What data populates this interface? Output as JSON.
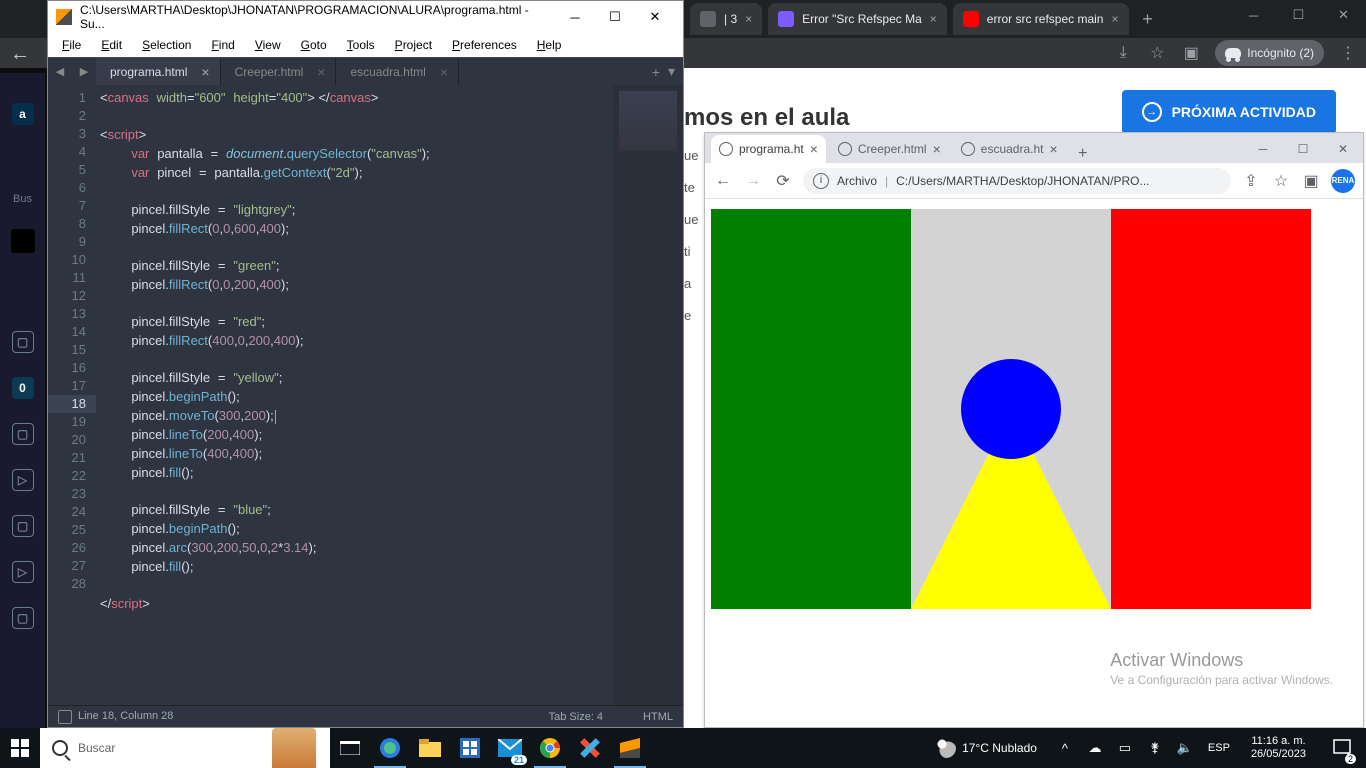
{
  "sublime": {
    "title": "C:\\Users\\MARTHA\\Desktop\\JHONATAN\\PROGRAMACION\\ALURA\\programa.html - Su...",
    "menu": [
      "File",
      "Edit",
      "Selection",
      "Find",
      "View",
      "Goto",
      "Tools",
      "Project",
      "Preferences",
      "Help"
    ],
    "tabs": [
      {
        "label": "programa.html",
        "active": true
      },
      {
        "label": "Creeper.html",
        "active": false
      },
      {
        "label": "escuadra.html",
        "active": false
      }
    ],
    "lines": [
      "1",
      "2",
      "3",
      "4",
      "5",
      "6",
      "7",
      "8",
      "9",
      "10",
      "11",
      "12",
      "13",
      "14",
      "15",
      "16",
      "17",
      "18",
      "19",
      "20",
      "21",
      "22",
      "23",
      "24",
      "25",
      "26",
      "27",
      "28"
    ],
    "current_line_index": 17,
    "status": {
      "pos": "Line 18, Column 28",
      "tab": "Tab Size: 4",
      "lang": "HTML"
    }
  },
  "bg_browser": {
    "tabs": [
      {
        "label": "| 3"
      },
      {
        "label": "Error \"Src Refspec Ma"
      },
      {
        "label": "error src refspec main"
      }
    ],
    "incognito": "Incógnito (2)",
    "heading": "mos en el aula",
    "next_btn": "PRÓXIMA ACTIVIDAD",
    "frag": "ue\nte\nue\nti\na\ne",
    "sidebar": {
      "logo": "a",
      "search": "Bus",
      "zero": "0"
    }
  },
  "chrome": {
    "tabs": [
      {
        "label": "programa.ht",
        "active": true
      },
      {
        "label": "Creeper.html",
        "active": false
      },
      {
        "label": "escuadra.ht",
        "active": false
      }
    ],
    "url_label": "Archivo",
    "url": "C:/Users/MARTHA/Desktop/JHONATAN/PRO..."
  },
  "watermark": {
    "t1": "Activar Windows",
    "t2": "Ve a Configuración para activar Windows."
  },
  "taskbar": {
    "search_placeholder": "Buscar",
    "weather": "17°C  Nublado",
    "lang": "ESP",
    "time": "11:16 a. m.",
    "date": "26/05/2023",
    "notif_count": "2"
  }
}
